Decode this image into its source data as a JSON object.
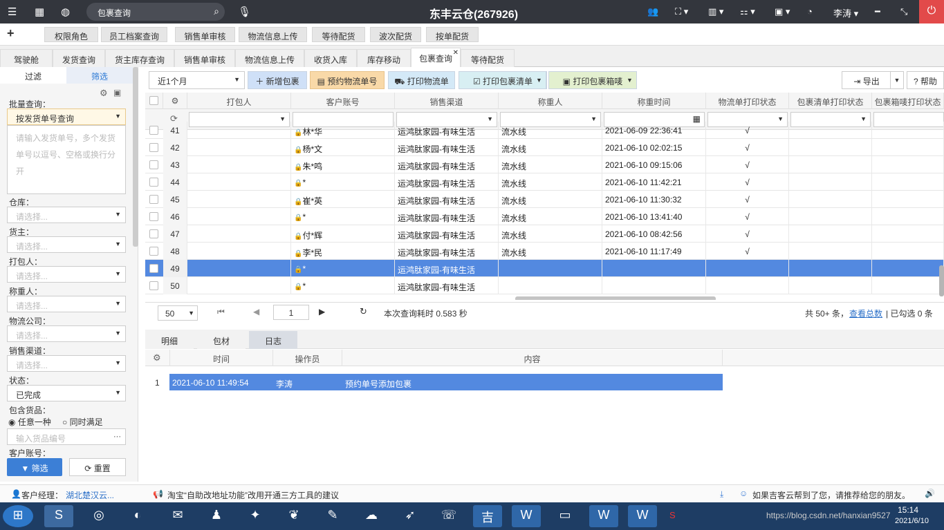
{
  "topbar": {
    "search": "包裹查询",
    "title": "东丰云仓(267926)",
    "user": "李涛"
  },
  "quick": [
    "权限角色",
    "员工档案查询",
    "销售单审核",
    "物流信息上传",
    "等待配货",
    "波次配货",
    "按单配货"
  ],
  "tabs": [
    "驾驶舱",
    "发货查询",
    "货主库存查询",
    "销售单审核",
    "物流信息上传",
    "收货入库",
    "库存移动",
    "包裹查询",
    "等待配货"
  ],
  "active_tab": "包裹查询",
  "sidebar": {
    "tab_filter": "过滤",
    "tab_screen": "筛选",
    "batch_label": "批量查询：",
    "batch_value": "按发货单号查询",
    "batch_placeholder": "请输入发货单号，多个发货单号以逗号、空格或换行分开",
    "fields": [
      {
        "label": "仓库：",
        "value": "请选择..."
      },
      {
        "label": "货主：",
        "value": "请选择..."
      },
      {
        "label": "打包人：",
        "value": "请选择..."
      },
      {
        "label": "称重人：",
        "value": "请选择..."
      },
      {
        "label": "物流公司：",
        "value": "请选择..."
      },
      {
        "label": "销售渠道：",
        "value": "请选择..."
      },
      {
        "label": "状态：",
        "value": "已完成"
      }
    ],
    "goods_label": "包含货品：",
    "radio_any": "任意一种",
    "radio_all": "同时满足",
    "goods_placeholder": "输入货品编号",
    "account_label": "客户账号：",
    "btn_filter": "筛选",
    "btn_reset": "重置"
  },
  "toolbar": {
    "period": "近1个月",
    "add": "新增包裹",
    "reserve": "预约物流单号",
    "print_logistics": "打印物流单",
    "print_list": "打印包裹清单",
    "print_box": "打印包裹箱唛",
    "export": "导出",
    "help": "帮助"
  },
  "grid": {
    "columns": [
      "打包人",
      "客户账号",
      "销售渠道",
      "称重人",
      "称重时间",
      "物流单打印状态",
      "包裹清单打印状态",
      "包裹箱唛打印状态"
    ],
    "rows": [
      {
        "no": "41",
        "packer": "",
        "account": "林*华",
        "channel": "运鸿肽家园-有味生活",
        "weigher": "流水线",
        "time": "2021-06-09 22:36:41",
        "status": "√"
      },
      {
        "no": "42",
        "packer": "",
        "account": "杨*文",
        "channel": "运鸿肽家园-有味生活",
        "weigher": "流水线",
        "time": "2021-06-10 02:02:15",
        "status": "√"
      },
      {
        "no": "43",
        "packer": "",
        "account": "朱*鸣",
        "channel": "运鸿肽家园-有味生活",
        "weigher": "流水线",
        "time": "2021-06-10 09:15:06",
        "status": "√"
      },
      {
        "no": "44",
        "packer": "",
        "account": "*",
        "channel": "运鸿肽家园-有味生活",
        "weigher": "流水线",
        "time": "2021-06-10 11:42:21",
        "status": "√"
      },
      {
        "no": "45",
        "packer": "",
        "account": "崔*英",
        "channel": "运鸿肽家园-有味生活",
        "weigher": "流水线",
        "time": "2021-06-10 11:30:32",
        "status": "√"
      },
      {
        "no": "46",
        "packer": "",
        "account": "*",
        "channel": "运鸿肽家园-有味生活",
        "weigher": "流水线",
        "time": "2021-06-10 13:41:40",
        "status": "√"
      },
      {
        "no": "47",
        "packer": "",
        "account": "付*辉",
        "channel": "运鸿肽家园-有味生活",
        "weigher": "流水线",
        "time": "2021-06-10 08:42:56",
        "status": "√"
      },
      {
        "no": "48",
        "packer": "",
        "account": "李*民",
        "channel": "运鸿肽家园-有味生活",
        "weigher": "流水线",
        "time": "2021-06-10 11:17:49",
        "status": "√"
      },
      {
        "no": "49",
        "packer": "",
        "account": "*",
        "channel": "运鸿肽家园-有味生活",
        "weigher": "",
        "time": "",
        "status": ""
      },
      {
        "no": "50",
        "packer": "",
        "account": "*",
        "channel": "运鸿肽家园-有味生活",
        "weigher": "",
        "time": "",
        "status": ""
      }
    ],
    "selected_row": "49"
  },
  "footer": {
    "page_size": "50",
    "page": "1",
    "elapsed": "本次查询耗时 0.583 秒",
    "total": "共 50+ 条，",
    "view_total": "查看总数",
    "checked": "| 已勾选 0 条"
  },
  "bottom_tabs": [
    "明细",
    "包材",
    "日志"
  ],
  "log": {
    "columns": [
      "时间",
      "操作员",
      "内容"
    ],
    "rows": [
      {
        "no": "1",
        "time": "2021-06-10 11:49:54",
        "operator": "李涛",
        "content": "预约单号添加包裹"
      }
    ]
  },
  "statusbar": {
    "manager_label": "客户经理：",
    "manager": "湖北楚汉云...",
    "notice": "淘宝“自助改地址功能”改用开通三方工具的建议",
    "recommend": "如果吉客云帮到了您，请推荐给您的朋友。"
  },
  "taskbar": {
    "watermark": "https://blog.csdn.net/hanxian9527",
    "time": "15:14",
    "date": "2021/6/10"
  }
}
